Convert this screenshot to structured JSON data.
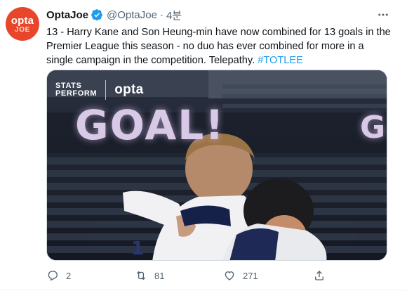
{
  "tweet": {
    "avatar": {
      "top": "opta",
      "bottom": "JOE"
    },
    "author_name": "OptaJoe",
    "handle": "@OptaJoe",
    "separator": "·",
    "time": "4분",
    "text": "13 - Harry Kane and Son Heung-min have now combined for 13 goals in the Premier League this season - no duo has ever combined for more in a single campaign in the competition. Telepathy.",
    "hashtag": "#TOTLEE",
    "media": {
      "brand_line1": "STATS",
      "brand_line2": "PERFORM",
      "brand_right": "opta",
      "banner_text": "GOAL!",
      "banner_partial": "G"
    },
    "actions": {
      "replies": "2",
      "retweets": "81",
      "likes": "271"
    }
  },
  "colors": {
    "accent": "#1d9bf0",
    "opta_red": "#e8462b",
    "text_secondary": "#536471"
  }
}
